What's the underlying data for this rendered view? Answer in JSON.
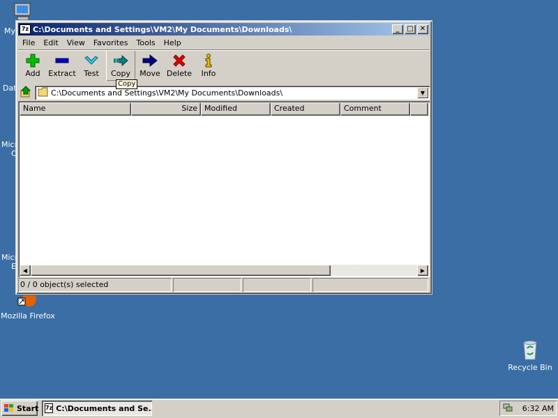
{
  "window": {
    "title": "C:\\Documents and Settings\\VM2\\My Documents\\Downloads\\",
    "app_icon": "7z",
    "controls": {
      "minimize": "_",
      "maximize": "□",
      "close": "✕"
    }
  },
  "menu": [
    "File",
    "Edit",
    "View",
    "Favorites",
    "Tools",
    "Help"
  ],
  "toolbar": {
    "buttons": [
      {
        "label": "Add",
        "icon": "plus-icon",
        "color": "#00c000"
      },
      {
        "label": "Extract",
        "icon": "minus-icon",
        "color": "#0000c0"
      },
      {
        "label": "Test",
        "icon": "check-icon",
        "color": "#00a0c0"
      },
      {
        "label": "Copy",
        "icon": "copy-arrow-icon",
        "color": "#008080"
      },
      {
        "label": "Move",
        "icon": "move-arrow-icon",
        "color": "#000080"
      },
      {
        "label": "Delete",
        "icon": "delete-x-icon",
        "color": "#e00000"
      },
      {
        "label": "Info",
        "icon": "info-icon",
        "color": "#c0a000"
      }
    ],
    "tooltip": "Copy"
  },
  "address": {
    "path": "C:\\Documents and Settings\\VM2\\My Documents\\Downloads\\"
  },
  "columns": [
    "Name",
    "Size",
    "Modified",
    "Created",
    "Comment"
  ],
  "status": {
    "selection": "0 / 0 object(s) selected"
  },
  "desktop": {
    "icons": [
      {
        "label": "My"
      },
      {
        "label": "Dat"
      },
      {
        "label": "Micr"
      },
      {
        "label": "C"
      },
      {
        "label": "Micr"
      },
      {
        "label": "E"
      },
      {
        "label": "Mozilla Firefox"
      },
      {
        "label": "Recycle Bin"
      }
    ]
  },
  "taskbar": {
    "start_label": "Start",
    "task_label": "C:\\Documents and Se...",
    "clock": "6:32 AM"
  },
  "colors": {
    "desktop": "#3a6ea5",
    "titlebar": "#0a246a",
    "face": "#d4d0c8"
  }
}
